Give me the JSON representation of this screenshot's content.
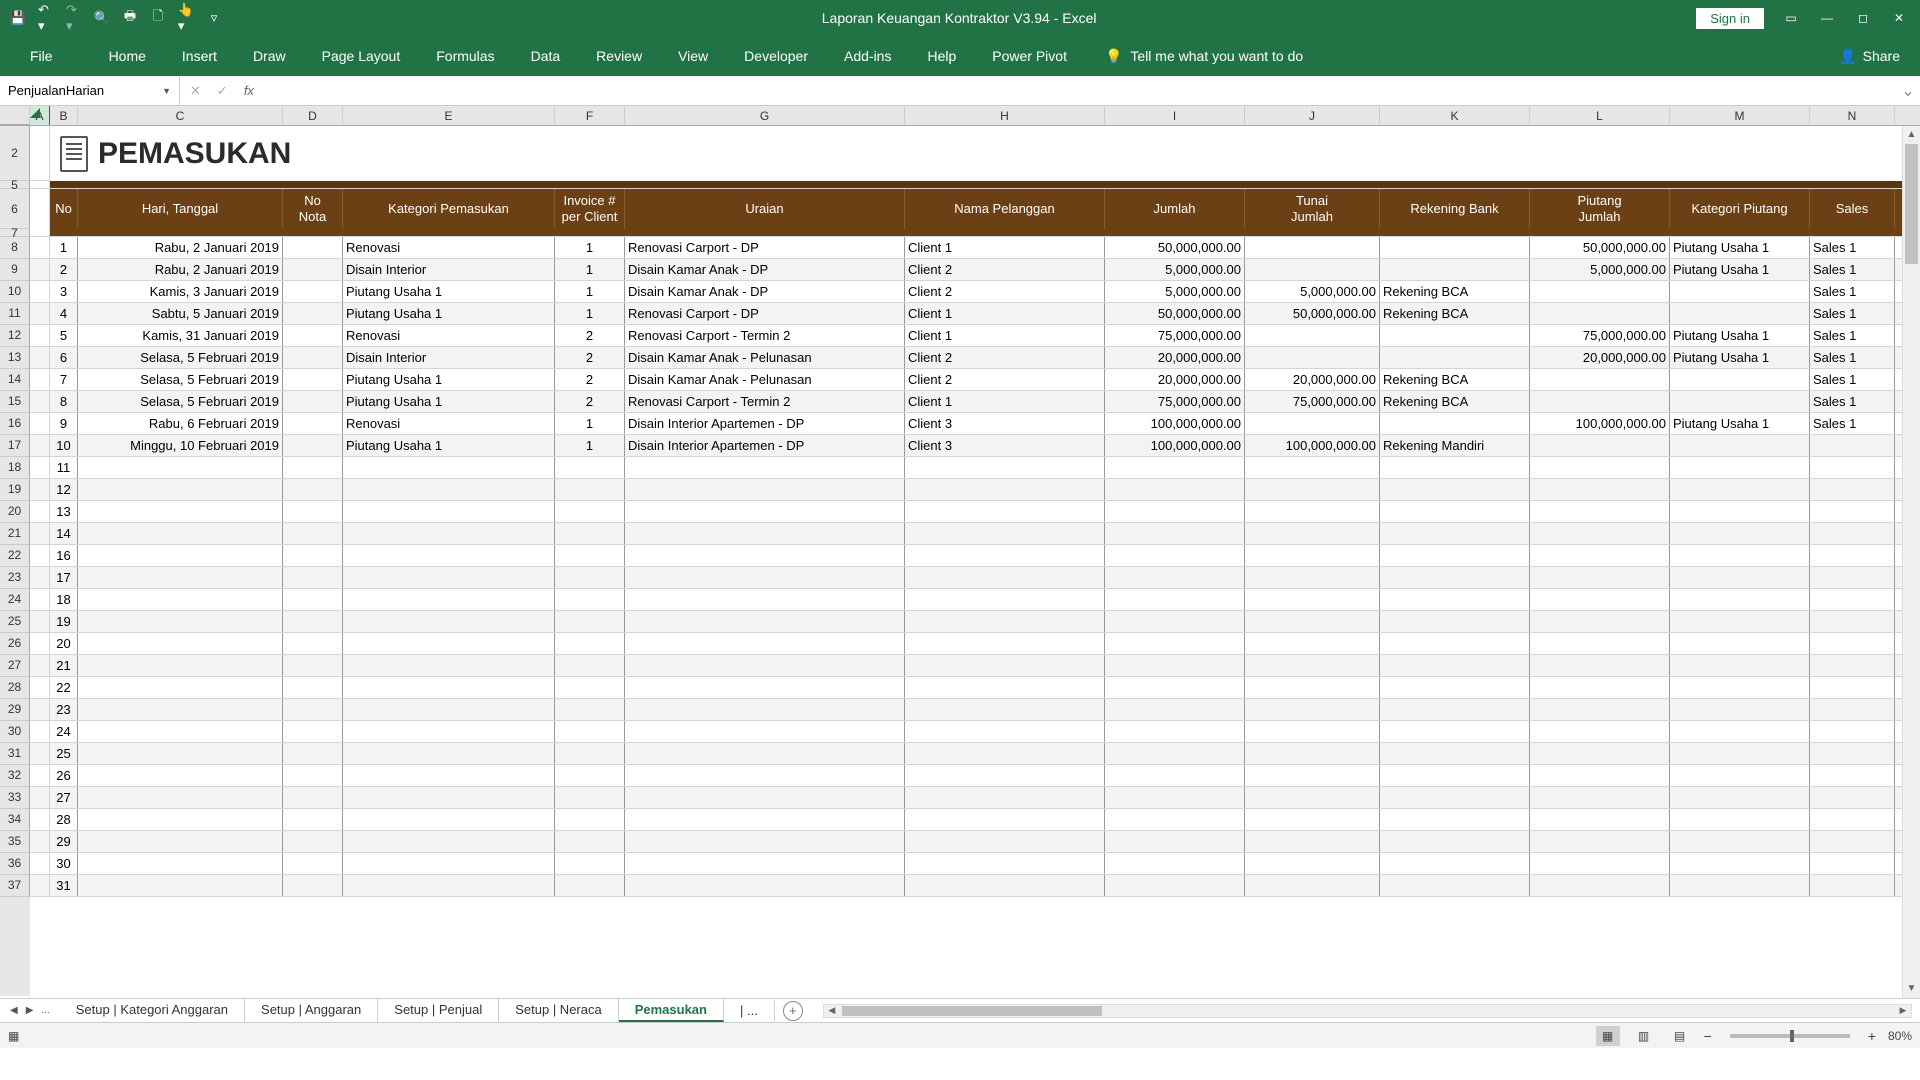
{
  "titlebar": {
    "title": "Laporan Keuangan Kontraktor V3.94  -  Excel",
    "signin": "Sign in"
  },
  "ribbon": {
    "file": "File",
    "tabs": [
      "Home",
      "Insert",
      "Draw",
      "Page Layout",
      "Formulas",
      "Data",
      "Review",
      "View",
      "Developer",
      "Add-ins",
      "Help",
      "Power Pivot"
    ],
    "tellme": "Tell me what you want to do",
    "share": "Share"
  },
  "namebox": "PenjualanHarian",
  "formula": "",
  "columns": [
    "A",
    "B",
    "C",
    "D",
    "E",
    "F",
    "G",
    "H",
    "I",
    "J",
    "K",
    "L",
    "M",
    "N"
  ],
  "page_title": "PEMASUKAN",
  "headers": {
    "B": "No",
    "C": "Hari, Tanggal",
    "D": "No\nNota",
    "E": "Kategori Pemasukan",
    "F": "Invoice #\nper Client",
    "G": "Uraian",
    "H": "Nama Pelanggan",
    "I": "Jumlah",
    "J": "Tunai\nJumlah",
    "K": "Rekening Bank",
    "L": "Piutang\nJumlah",
    "M": "Kategori Piutang",
    "N": "Sales"
  },
  "rows": [
    {
      "no": "1",
      "tgl": "Rabu, 2 Januari 2019",
      "nota": "",
      "kat": "Renovasi",
      "inv": "1",
      "ur": "Renovasi Carport - DP",
      "pel": "Client 1",
      "jml": "50,000,000.00",
      "tunai": "",
      "rek": "",
      "piu": "50,000,000.00",
      "kpiu": "Piutang Usaha 1",
      "sales": "Sales 1"
    },
    {
      "no": "2",
      "tgl": "Rabu, 2 Januari 2019",
      "nota": "",
      "kat": "Disain Interior",
      "inv": "1",
      "ur": "Disain Kamar Anak - DP",
      "pel": "Client 2",
      "jml": "5,000,000.00",
      "tunai": "",
      "rek": "",
      "piu": "5,000,000.00",
      "kpiu": "Piutang Usaha 1",
      "sales": "Sales 1"
    },
    {
      "no": "3",
      "tgl": "Kamis, 3 Januari 2019",
      "nota": "",
      "kat": "Piutang Usaha 1",
      "inv": "1",
      "ur": "Disain Kamar Anak - DP",
      "pel": "Client 2",
      "jml": "5,000,000.00",
      "tunai": "5,000,000.00",
      "rek": "Rekening BCA",
      "piu": "",
      "kpiu": "",
      "sales": "Sales 1"
    },
    {
      "no": "4",
      "tgl": "Sabtu, 5 Januari 2019",
      "nota": "",
      "kat": "Piutang Usaha 1",
      "inv": "1",
      "ur": "Renovasi Carport - DP",
      "pel": "Client 1",
      "jml": "50,000,000.00",
      "tunai": "50,000,000.00",
      "rek": "Rekening BCA",
      "piu": "",
      "kpiu": "",
      "sales": "Sales 1"
    },
    {
      "no": "5",
      "tgl": "Kamis, 31 Januari 2019",
      "nota": "",
      "kat": "Renovasi",
      "inv": "2",
      "ur": "Renovasi Carport - Termin 2",
      "pel": "Client 1",
      "jml": "75,000,000.00",
      "tunai": "",
      "rek": "",
      "piu": "75,000,000.00",
      "kpiu": "Piutang Usaha 1",
      "sales": "Sales 1"
    },
    {
      "no": "6",
      "tgl": "Selasa, 5 Februari 2019",
      "nota": "",
      "kat": "Disain Interior",
      "inv": "2",
      "ur": "Disain Kamar Anak - Pelunasan",
      "pel": "Client 2",
      "jml": "20,000,000.00",
      "tunai": "",
      "rek": "",
      "piu": "20,000,000.00",
      "kpiu": "Piutang Usaha 1",
      "sales": "Sales 1"
    },
    {
      "no": "7",
      "tgl": "Selasa, 5 Februari 2019",
      "nota": "",
      "kat": "Piutang Usaha 1",
      "inv": "2",
      "ur": "Disain Kamar Anak - Pelunasan",
      "pel": "Client 2",
      "jml": "20,000,000.00",
      "tunai": "20,000,000.00",
      "rek": "Rekening BCA",
      "piu": "",
      "kpiu": "",
      "sales": "Sales 1"
    },
    {
      "no": "8",
      "tgl": "Selasa, 5 Februari 2019",
      "nota": "",
      "kat": "Piutang Usaha 1",
      "inv": "2",
      "ur": "Renovasi Carport - Termin 2",
      "pel": "Client 1",
      "jml": "75,000,000.00",
      "tunai": "75,000,000.00",
      "rek": "Rekening BCA",
      "piu": "",
      "kpiu": "",
      "sales": "Sales 1"
    },
    {
      "no": "9",
      "tgl": "Rabu, 6 Februari 2019",
      "nota": "",
      "kat": "Renovasi",
      "inv": "1",
      "ur": "Disain Interior Apartemen - DP",
      "pel": "Client 3",
      "jml": "100,000,000.00",
      "tunai": "",
      "rek": "",
      "piu": "100,000,000.00",
      "kpiu": "Piutang Usaha 1",
      "sales": "Sales 1"
    },
    {
      "no": "10",
      "tgl": "Minggu, 10 Februari 2019",
      "nota": "",
      "kat": "Piutang Usaha 1",
      "inv": "1",
      "ur": "Disain Interior Apartemen - DP",
      "pel": "Client 3",
      "jml": "100,000,000.00",
      "tunai": "100,000,000.00",
      "rek": "Rekening Mandiri",
      "piu": "",
      "kpiu": "",
      "sales": ""
    }
  ],
  "empty_nos": [
    "11",
    "12",
    "13",
    "14",
    "16",
    "17",
    "18",
    "19",
    "20",
    "21",
    "22",
    "23",
    "24",
    "25",
    "26",
    "27",
    "28",
    "29",
    "30",
    "31"
  ],
  "row_numbers_visible_start": 2,
  "sheet_tabs": {
    "list": [
      "Setup | Kategori Anggaran",
      "Setup | Anggaran",
      "Setup | Penjual",
      "Setup | Neraca",
      "Pemasukan"
    ],
    "active": "Pemasukan",
    "overflow": "| ..."
  },
  "zoom": "80%"
}
